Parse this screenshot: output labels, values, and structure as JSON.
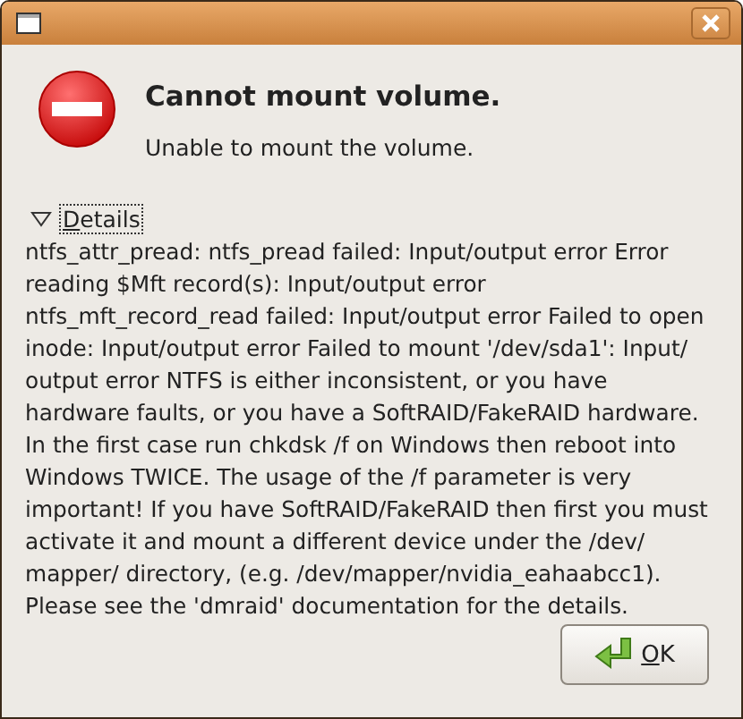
{
  "heading": "Cannot mount volume.",
  "message": "Unable to mount the volume.",
  "details": {
    "label": "Details",
    "expanded": true,
    "lines": [
      "ntfs_attr_pread: ntfs_pread failed: Input/output error Error",
      "reading $Mft record(s): Input/output error",
      "ntfs_mft_record_read failed: Input/output error Failed to open",
      "inode: Input/output error Failed to mount '/dev/sda1': Input/",
      "output error NTFS is either inconsistent, or you have",
      "hardware faults, or you have a SoftRAID/FakeRAID hardware.",
      "In the first case run chkdsk /f on Windows then reboot into",
      "Windows TWICE. The usage of the /f parameter is very",
      "important! If you have SoftRAID/FakeRAID then first you must",
      "activate it and mount a different device under the /dev/",
      "mapper/ directory, (e.g. /dev/mapper/nvidia_eahaabcc1).",
      "Please see the 'dmraid' documentation for the details."
    ]
  },
  "buttons": [
    {
      "label": "OK"
    }
  ]
}
